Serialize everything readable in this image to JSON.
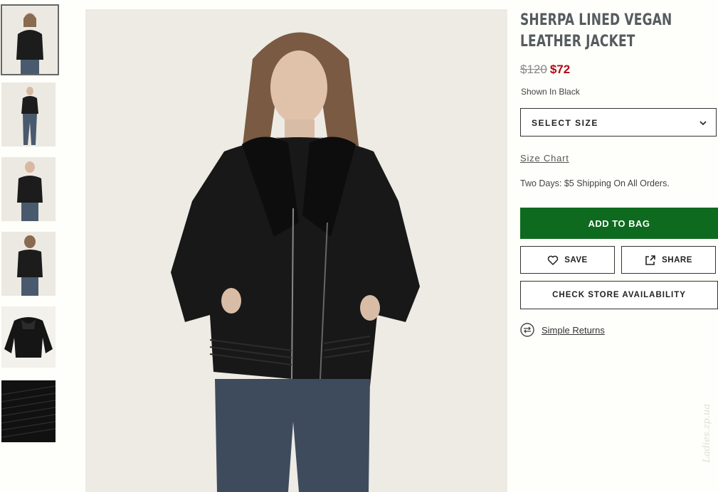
{
  "product": {
    "title": "SHERPA LINED VEGAN LEATHER JACKET",
    "price_original": "$120",
    "price_sale": "$72",
    "shown_in": "Shown In Black"
  },
  "size_select": {
    "label": "SELECT SIZE"
  },
  "links": {
    "size_chart": "Size Chart",
    "simple_returns": "Simple Returns"
  },
  "shipping_note": "Two Days: $5 Shipping On All Orders.",
  "buttons": {
    "add_to_bag": "ADD TO BAG",
    "save": "SAVE",
    "share": "SHARE",
    "check_store": "CHECK STORE AVAILABILITY"
  },
  "thumbnails": [
    {
      "alt": "model front view"
    },
    {
      "alt": "model full body"
    },
    {
      "alt": "model jacket front"
    },
    {
      "alt": "model back view"
    },
    {
      "alt": "jacket flat lay"
    },
    {
      "alt": "quilted detail"
    }
  ],
  "watermark": "Ladies.zp.ua",
  "colors": {
    "accent": "#0e6a1f",
    "sale": "#b00a14",
    "background": "#fefefa"
  },
  "icons": [
    "chevron-down-icon",
    "heart-icon",
    "share-icon",
    "returns-icon"
  ]
}
